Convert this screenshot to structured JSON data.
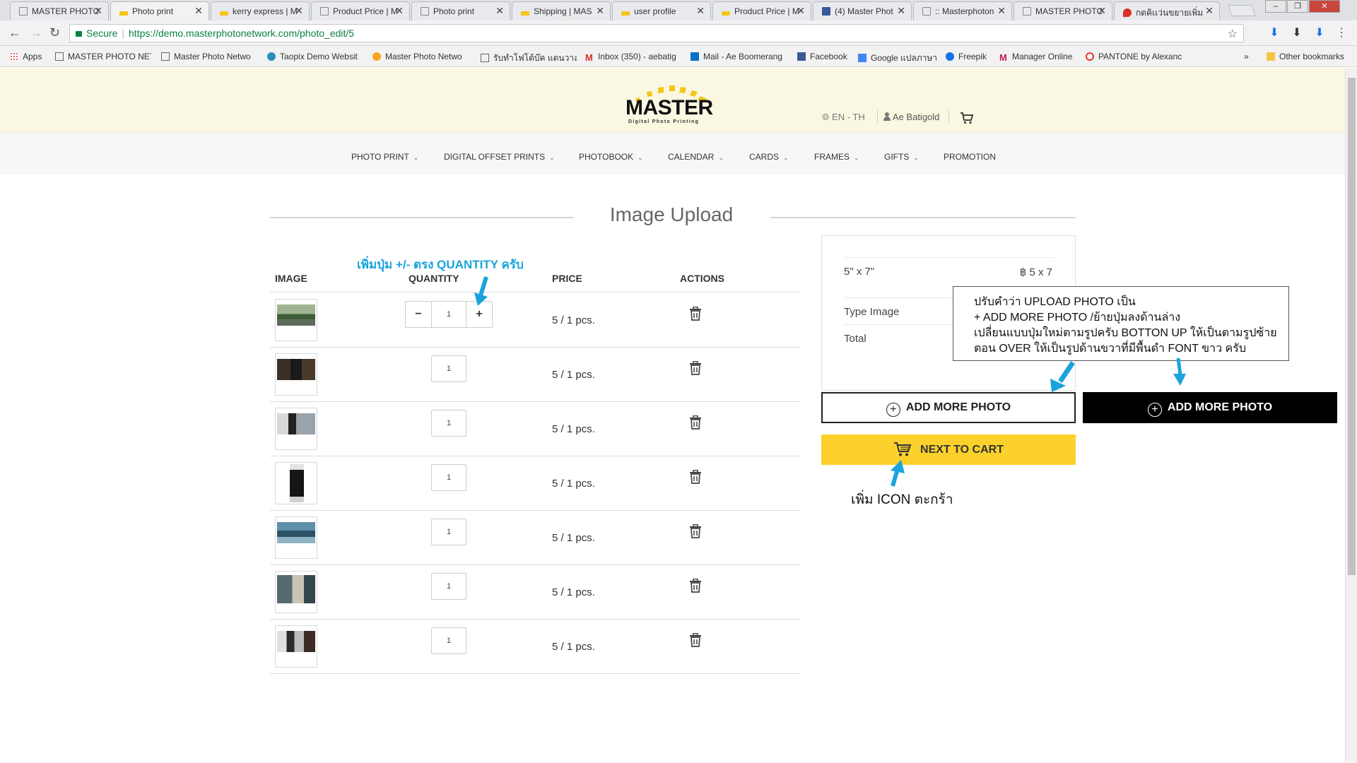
{
  "browser": {
    "tabs": [
      {
        "title": "MASTER PHOTC",
        "icon": "page-icon",
        "active": false
      },
      {
        "title": "Photo print",
        "icon": "brand-icon",
        "active": true
      },
      {
        "title": "kerry express | M",
        "icon": "brand-icon",
        "active": false
      },
      {
        "title": "Product Price | M",
        "icon": "page-icon",
        "active": false
      },
      {
        "title": "Photo print",
        "icon": "page-icon",
        "active": false
      },
      {
        "title": "Shipping | MAS",
        "icon": "brand-icon",
        "active": false
      },
      {
        "title": "user profile",
        "icon": "brand-icon",
        "active": false
      },
      {
        "title": "Product Price | M",
        "icon": "brand-icon",
        "active": false
      },
      {
        "title": "(4) Master Phot",
        "icon": "facebook-icon",
        "active": false
      },
      {
        "title": ":: Masterphoton",
        "icon": "page-icon",
        "active": false
      },
      {
        "title": "MASTER PHOTC",
        "icon": "page-icon",
        "active": false
      },
      {
        "title": "กดคิเเว่นขยายเพิ่ม",
        "icon": "maps-icon",
        "active": false
      }
    ],
    "secure_label": "Secure",
    "url": "https://demo.masterphotonetwork.com/photo_edit/5",
    "bookmarks": [
      {
        "label": "Apps",
        "icon": "apps-grid-icon"
      },
      {
        "label": "MASTER PHOTO NET",
        "icon": "page-icon"
      },
      {
        "label": "Master Photo Netwo",
        "icon": "page-icon"
      },
      {
        "label": "Taopix Demo Websit",
        "icon": "taopix-icon"
      },
      {
        "label": "Master Photo Netwo",
        "icon": "globe-icon"
      },
      {
        "label": "รับทำโฟโต้บ๊ค แตนวาล 8",
        "icon": "page-icon"
      },
      {
        "label": "Inbox (350) - aebatig",
        "icon": "gmail-icon"
      },
      {
        "label": "Mail - Ae Boomerang",
        "icon": "outlook-icon"
      },
      {
        "label": "Facebook",
        "icon": "facebook-icon"
      },
      {
        "label": "Google แปลภาษา",
        "icon": "translate-icon"
      },
      {
        "label": "Freepik",
        "icon": "freepik-icon"
      },
      {
        "label": "Manager Online",
        "icon": "gmail-icon"
      },
      {
        "label": "PANTONE by Alexanc",
        "icon": "pantone-icon"
      }
    ],
    "bookmarks_overflow": "»",
    "other_bookmarks": "Other bookmarks"
  },
  "header": {
    "logo_text": "MASTER",
    "logo_sub": "Digital Photo Printing",
    "lang": "EN - TH",
    "user": "Ae Batigold"
  },
  "nav": [
    {
      "label": "PHOTO PRINT",
      "dropdown": true
    },
    {
      "label": "DIGITAL OFFSET PRINTS",
      "dropdown": true
    },
    {
      "label": "PHOTOBOOK",
      "dropdown": true
    },
    {
      "label": "CALENDAR",
      "dropdown": true
    },
    {
      "label": "CARDS",
      "dropdown": true
    },
    {
      "label": "FRAMES",
      "dropdown": true
    },
    {
      "label": "GIFTS",
      "dropdown": true
    },
    {
      "label": "PROMOTION",
      "dropdown": false
    }
  ],
  "page": {
    "title": "Image Upload",
    "table": {
      "headers": {
        "image": "IMAGE",
        "quantity": "QUANTITY",
        "price": "PRICE",
        "actions": "ACTIONS"
      },
      "rows": [
        {
          "quantity": "1",
          "price": "5 / 1 pcs.",
          "has_stepper": true
        },
        {
          "quantity": "1",
          "price": "5 / 1 pcs.",
          "has_stepper": false
        },
        {
          "quantity": "1",
          "price": "5 / 1 pcs.",
          "has_stepper": false
        },
        {
          "quantity": "1",
          "price": "5 / 1 pcs.",
          "has_stepper": false
        },
        {
          "quantity": "1",
          "price": "5 / 1 pcs.",
          "has_stepper": false
        },
        {
          "quantity": "1",
          "price": "5 / 1 pcs.",
          "has_stepper": false
        },
        {
          "quantity": "1",
          "price": "5 / 1 pcs.",
          "has_stepper": false
        }
      ],
      "stepper": {
        "minus": "−",
        "plus": "+"
      }
    },
    "summary": {
      "size_label": "5\" x 7\"",
      "size_value": "฿ 5 x 7",
      "type_label": "Type Image",
      "total_label": "Total"
    },
    "buttons": {
      "add_more_photo": "ADD MORE PHOTO",
      "add_more_photo_hover": "ADD MORE PHOTO",
      "next_to_cart": "NEXT TO CART"
    }
  },
  "annotations": {
    "quantity_note": "เพิ่มปุ่ม +/- ตรง QUANTITY ครับ",
    "button_note": [
      "ปรับคำว่า UPLOAD PHOTO  เป็น",
      "+ ADD MORE PHOTO /ย้ายปุ่มลงด้านล่าง",
      "เปลี่ยนแบบปุ่มใหม่ตามรูปครับ BOTTON UP ให้เป็นตามรูปซ้าย",
      "ตอน OVER ให้เป็นรูปด้านขวาที่มีพื้นดำ FONT ขาว ครับ"
    ],
    "cart_note": "เพิ่ม ICON ตะกร้า"
  },
  "colors": {
    "header_bg": "#faf8e1",
    "accent_yellow": "#fcd12b",
    "annotation_blue": "#1aa3dc",
    "button_dark": "#000000"
  }
}
